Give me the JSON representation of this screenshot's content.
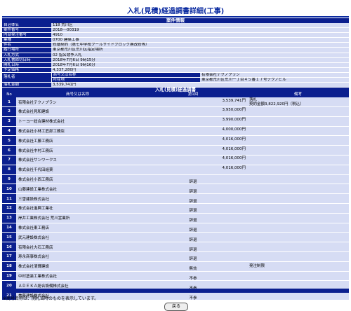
{
  "page": {
    "title": "入札(見積)経過調書詳細(工事)",
    "case_info_header": "案件情報",
    "bid_header": "入札(見積)経過調書",
    "footnote": "※商号名称は、開札当時のものを表示しています。",
    "back_label": "戻る"
  },
  "case_info": [
    {
      "label": "自治体名",
      "value": "118 荒川区"
    },
    {
      "label": "案件番号",
      "value": "2018---00319"
    },
    {
      "label": "内部発注番号",
      "value": "4910"
    },
    {
      "label": "業種",
      "value": "0700 建築工事"
    },
    {
      "label": "件名",
      "value": "修繕契約（第七中学校プールサイドブロック塀改修等）"
    },
    {
      "label": "履行場所",
      "value": "東京都荒川区荒川区指定場所"
    },
    {
      "label": "入札方式",
      "value": "02 指名競争入札"
    },
    {
      "label": "入札書締切日時",
      "value": "2018年7月6日 9時15分"
    },
    {
      "label": "開札日時",
      "value": "2018年7月6日 9時16分"
    },
    {
      "label": "予定価格",
      "value": "4,337,280円"
    }
  ],
  "winner": {
    "label": "落札者",
    "name_label": "商号又は名称",
    "name": "有限会社テクノプラン",
    "addr_label": "所在地",
    "addr": "東京都荒川区荒川一丁目４５番１７号テクノビル"
  },
  "winning_amount": {
    "label": "落札金額",
    "value": "3,539,741円"
  },
  "bid_columns": {
    "no": "No",
    "name": "商号又は名称",
    "round1": "第1回",
    "note": "備考"
  },
  "bids": [
    {
      "no": "1",
      "name": "有限会社テクノプラン",
      "round1": "3,539,741円",
      "note1": "落札",
      "note2": "契約金額3,822,920円（税込）"
    },
    {
      "no": "2",
      "name": "株式会社見和建設",
      "round1": "3,950,000円",
      "note1": "",
      "note2": ""
    },
    {
      "no": "3",
      "name": "トーヨー総合建材株式会社",
      "round1": "3,990,000円",
      "note1": "",
      "note2": ""
    },
    {
      "no": "4",
      "name": "株式会社小林工匠部工務店",
      "round1": "4,000,000円",
      "note1": "",
      "note2": ""
    },
    {
      "no": "5",
      "name": "株式会社工藤工務店",
      "round1": "4,016,000円",
      "note1": "",
      "note2": ""
    },
    {
      "no": "6",
      "name": "株式会社中村工務店",
      "round1": "4,016,000円",
      "note1": "",
      "note2": ""
    },
    {
      "no": "7",
      "name": "株式会社サンワークス",
      "round1": "4,016,000円",
      "note1": "",
      "note2": ""
    },
    {
      "no": "8",
      "name": "株式会社千代田組薬",
      "round1": "4,016,000円",
      "note1": "",
      "note2": ""
    },
    {
      "no": "9",
      "name": "株式会社小西工務店",
      "round1": "辞退",
      "note1": "",
      "note2": ""
    },
    {
      "no": "10",
      "name": "山藤建設工業株式会社",
      "round1": "辞退",
      "note1": "",
      "note2": ""
    },
    {
      "no": "11",
      "name": "三雪建設株式会社",
      "round1": "辞退",
      "note1": "",
      "note2": ""
    },
    {
      "no": "12",
      "name": "株式会社進興工業社",
      "round1": "辞退",
      "note1": "",
      "note2": ""
    },
    {
      "no": "13",
      "name": "岸井工業株式会社 荒川営業所",
      "round1": "辞退",
      "note1": "",
      "note2": ""
    },
    {
      "no": "14",
      "name": "株式会社東工務店",
      "round1": "辞退",
      "note1": "",
      "note2": ""
    },
    {
      "no": "15",
      "name": "武元建設株式会社",
      "round1": "辞退",
      "note1": "",
      "note2": ""
    },
    {
      "no": "16",
      "name": "有限会社大石工務店",
      "round1": "辞退",
      "note1": "",
      "note2": ""
    },
    {
      "no": "17",
      "name": "寿永商事株式会社",
      "round1": "辞退",
      "note1": "",
      "note2": ""
    },
    {
      "no": "18",
      "name": "株式会社清輝建設",
      "round1": "無効",
      "note1": "発注制限",
      "note2": ""
    },
    {
      "no": "19",
      "name": "中村塗装工業株式会社",
      "round1": "不参",
      "note1": "",
      "note2": ""
    },
    {
      "no": "20",
      "name": "ＡＤＥＫＡ総合設備株式会社",
      "round1": "不参",
      "note1": "",
      "note2": ""
    },
    {
      "no": "21",
      "name": "美藤建設株式会社",
      "round1": "不参",
      "note1": "",
      "note2": ""
    }
  ]
}
